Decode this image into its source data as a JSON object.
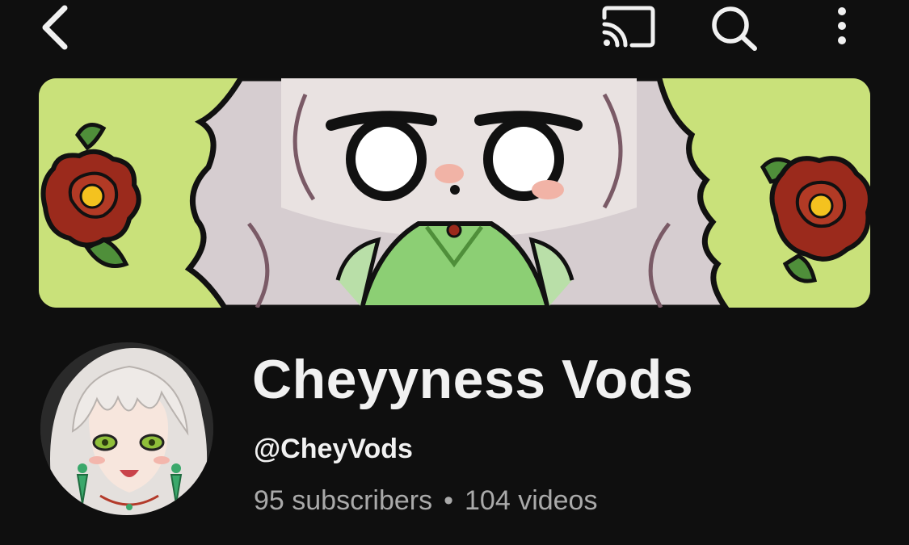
{
  "header": {
    "back_icon": "back-arrow-icon",
    "cast_icon": "cast-icon",
    "search_icon": "search-icon",
    "more_icon": "more-vertical-icon"
  },
  "channel": {
    "name": "Cheyyness Vods",
    "handle": "@CheyVods",
    "subscribers": "95 subscribers",
    "separator": "•",
    "videos": "104 videos"
  },
  "colors": {
    "background": "#0f0f0f",
    "text_primary": "#f1f1f1",
    "text_secondary": "#aaaaaa",
    "banner_green": "#c9e17a",
    "flower_red": "#9b2a1c",
    "flower_center": "#f4c21f"
  }
}
